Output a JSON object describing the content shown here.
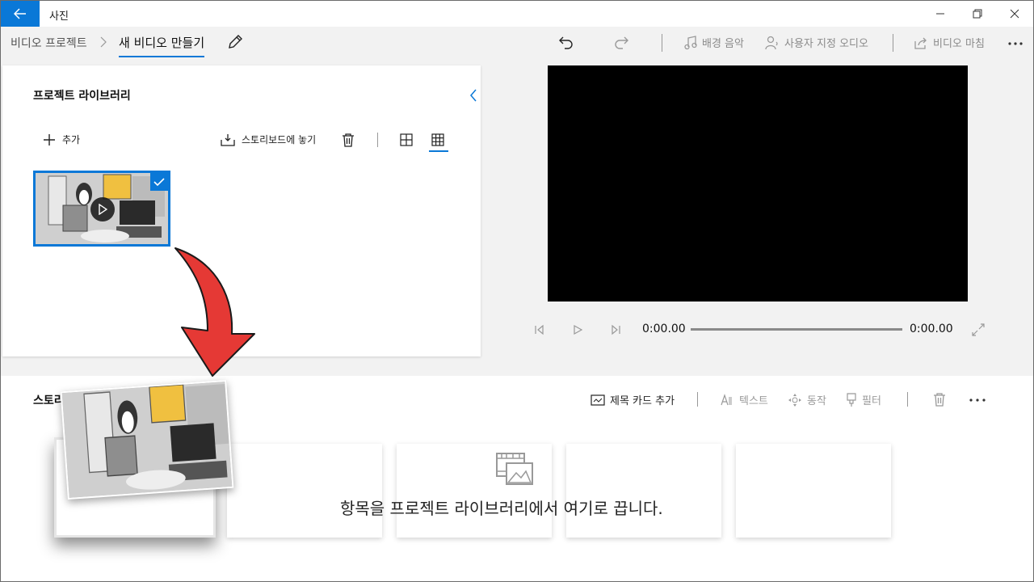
{
  "app": {
    "title": "사진"
  },
  "breadcrumb": {
    "parent": "비디오 프로젝트",
    "current": "새 비디오 만들기"
  },
  "toolbar": {
    "bg_music": "배경 음악",
    "custom_audio": "사용자 지정 오디오",
    "finish_video": "비디오 마침"
  },
  "library": {
    "title": "프로젝트 라이브러리",
    "add_label": "추가",
    "place_label": "스토리보드에 놓기"
  },
  "player": {
    "current_time": "0:00.00",
    "total_time": "0:00.00",
    "progress": 0
  },
  "storyboard": {
    "title": "스토리보드",
    "title_card": "제목 카드 추가",
    "text": "텍스트",
    "motion": "동작",
    "filter": "필터",
    "drop_hint": "항목을 프로젝트 라이브러리에서 여기로 끕니다."
  },
  "colors": {
    "accent": "#0a78d7",
    "arrow": "#e53935"
  }
}
